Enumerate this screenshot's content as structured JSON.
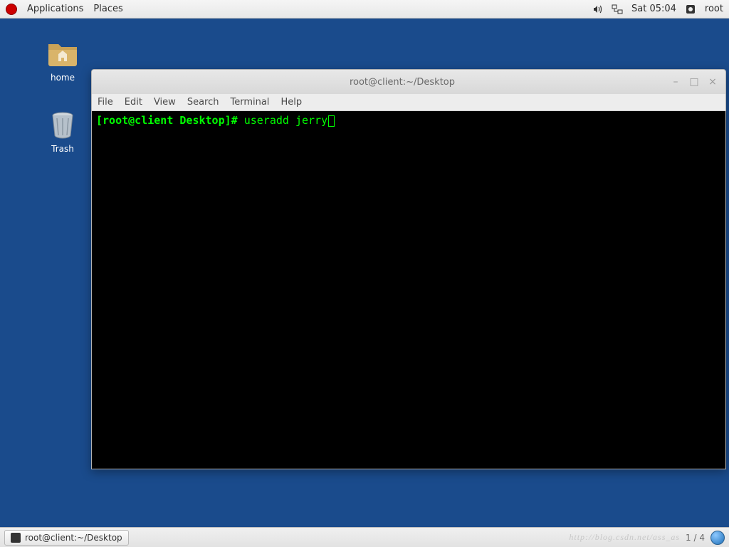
{
  "top_panel": {
    "applications": "Applications",
    "places": "Places",
    "datetime": "Sat 05:04",
    "user": "root"
  },
  "desktop": {
    "home_label": "home",
    "trash_label": "Trash"
  },
  "terminal": {
    "title": "root@client:~/Desktop",
    "menus": {
      "file": "File",
      "edit": "Edit",
      "view": "View",
      "search": "Search",
      "terminal": "Terminal",
      "help": "Help"
    },
    "prompt": "[root@client Desktop]# ",
    "command": "useradd jerry"
  },
  "bottom_panel": {
    "task_label": "root@client:~/Desktop",
    "page_indicator": "1 / 4",
    "watermark": "http://blog.csdn.net/ass_as"
  }
}
